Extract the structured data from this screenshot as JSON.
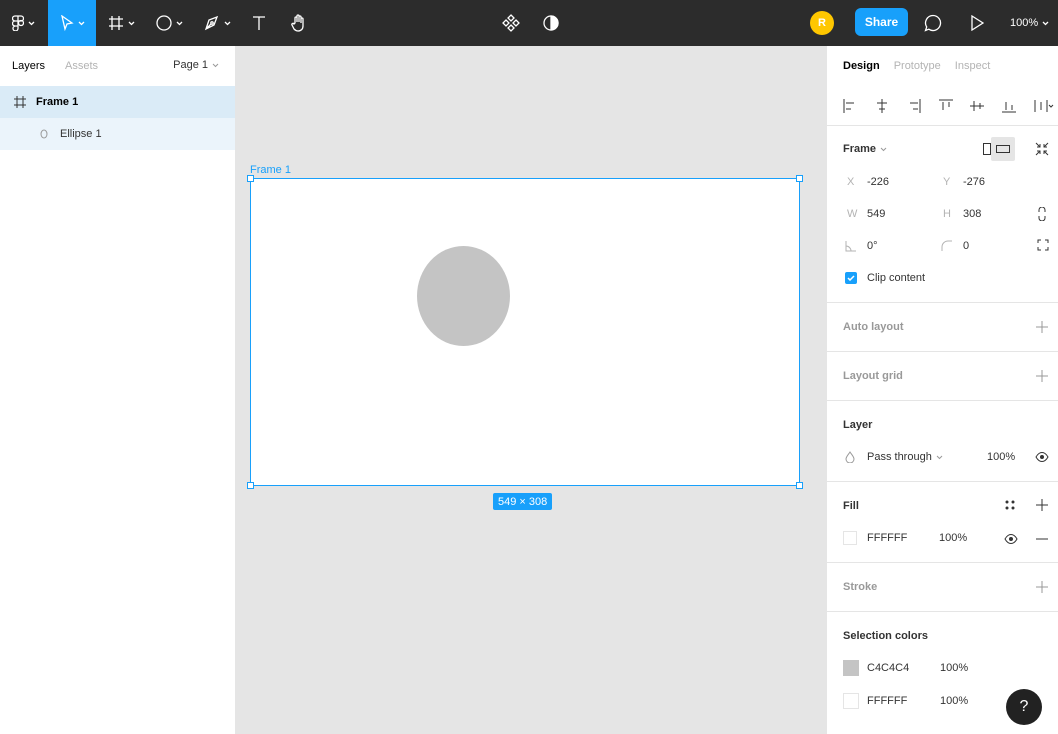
{
  "toolbar": {
    "share_label": "Share",
    "avatar_initial": "R",
    "zoom": "100%"
  },
  "left_panel": {
    "tabs": [
      "Layers",
      "Assets"
    ],
    "page": "Page 1",
    "layers": [
      {
        "name": "Frame 1"
      },
      {
        "name": "Ellipse 1"
      }
    ]
  },
  "canvas": {
    "frame_label": "Frame 1",
    "dimensions": "549 × 308"
  },
  "right_panel": {
    "tabs": [
      "Design",
      "Prototype",
      "Inspect"
    ],
    "frame": {
      "title": "Frame",
      "x_label": "X",
      "x": "-226",
      "y_label": "Y",
      "y": "-276",
      "w_label": "W",
      "w": "549",
      "h_label": "H",
      "h": "308",
      "rotation": "0°",
      "radius": "0",
      "clip_label": "Clip content"
    },
    "auto_layout": "Auto layout",
    "layout_grid": "Layout grid",
    "layer": {
      "title": "Layer",
      "blend": "Pass through",
      "opacity": "100%"
    },
    "fill": {
      "title": "Fill",
      "hex": "FFFFFF",
      "opacity": "100%"
    },
    "stroke": "Stroke",
    "selection_colors": {
      "title": "Selection colors",
      "items": [
        {
          "hex": "C4C4C4",
          "opacity": "100%"
        },
        {
          "hex": "FFFFFF",
          "opacity": "100%"
        }
      ]
    }
  },
  "help": "?",
  "colors": {
    "accent": "#18a0fb",
    "topbar": "#2c2c2c",
    "ellipse": "#c4c4c4",
    "avatar": "#ffc700"
  }
}
